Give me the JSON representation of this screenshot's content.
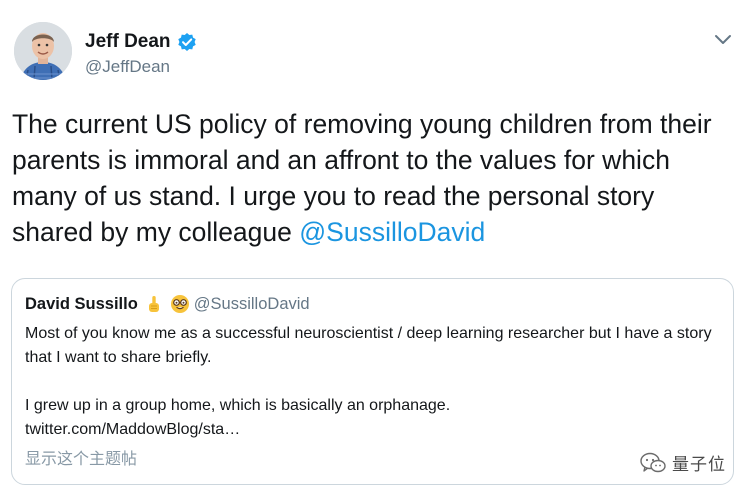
{
  "tweet": {
    "author": {
      "name": "Jeff Dean",
      "handle": "@JeffDean",
      "verified": true
    },
    "text_main": "The current US policy of removing young children from their parents is immoral and an affront to the values for which many of us stand.  I urge you to read the personal story shared by my colleague ",
    "mention": "@SussilloDavid"
  },
  "quoted_tweet": {
    "author": {
      "name": "David Sussillo",
      "handle": "@SussilloDavid",
      "emojis": [
        "pointing-up-emoji",
        "nerd-face-emoji"
      ]
    },
    "line1": "Most of you know me as a successful neuroscientist / deep learning researcher but I have a story that I want to share briefly.",
    "line2": "I grew up in a group home, which is basically an orphanage.",
    "link": "twitter.com/MaddowBlog/sta…",
    "show_thread": "显示这个主题帖"
  },
  "watermark": {
    "text": "量子位",
    "icon": "wechat-icon"
  },
  "colors": {
    "link": "#1b95e0",
    "secondary": "#657786",
    "border": "#ccd6dd",
    "verified": "#1da1f2"
  }
}
